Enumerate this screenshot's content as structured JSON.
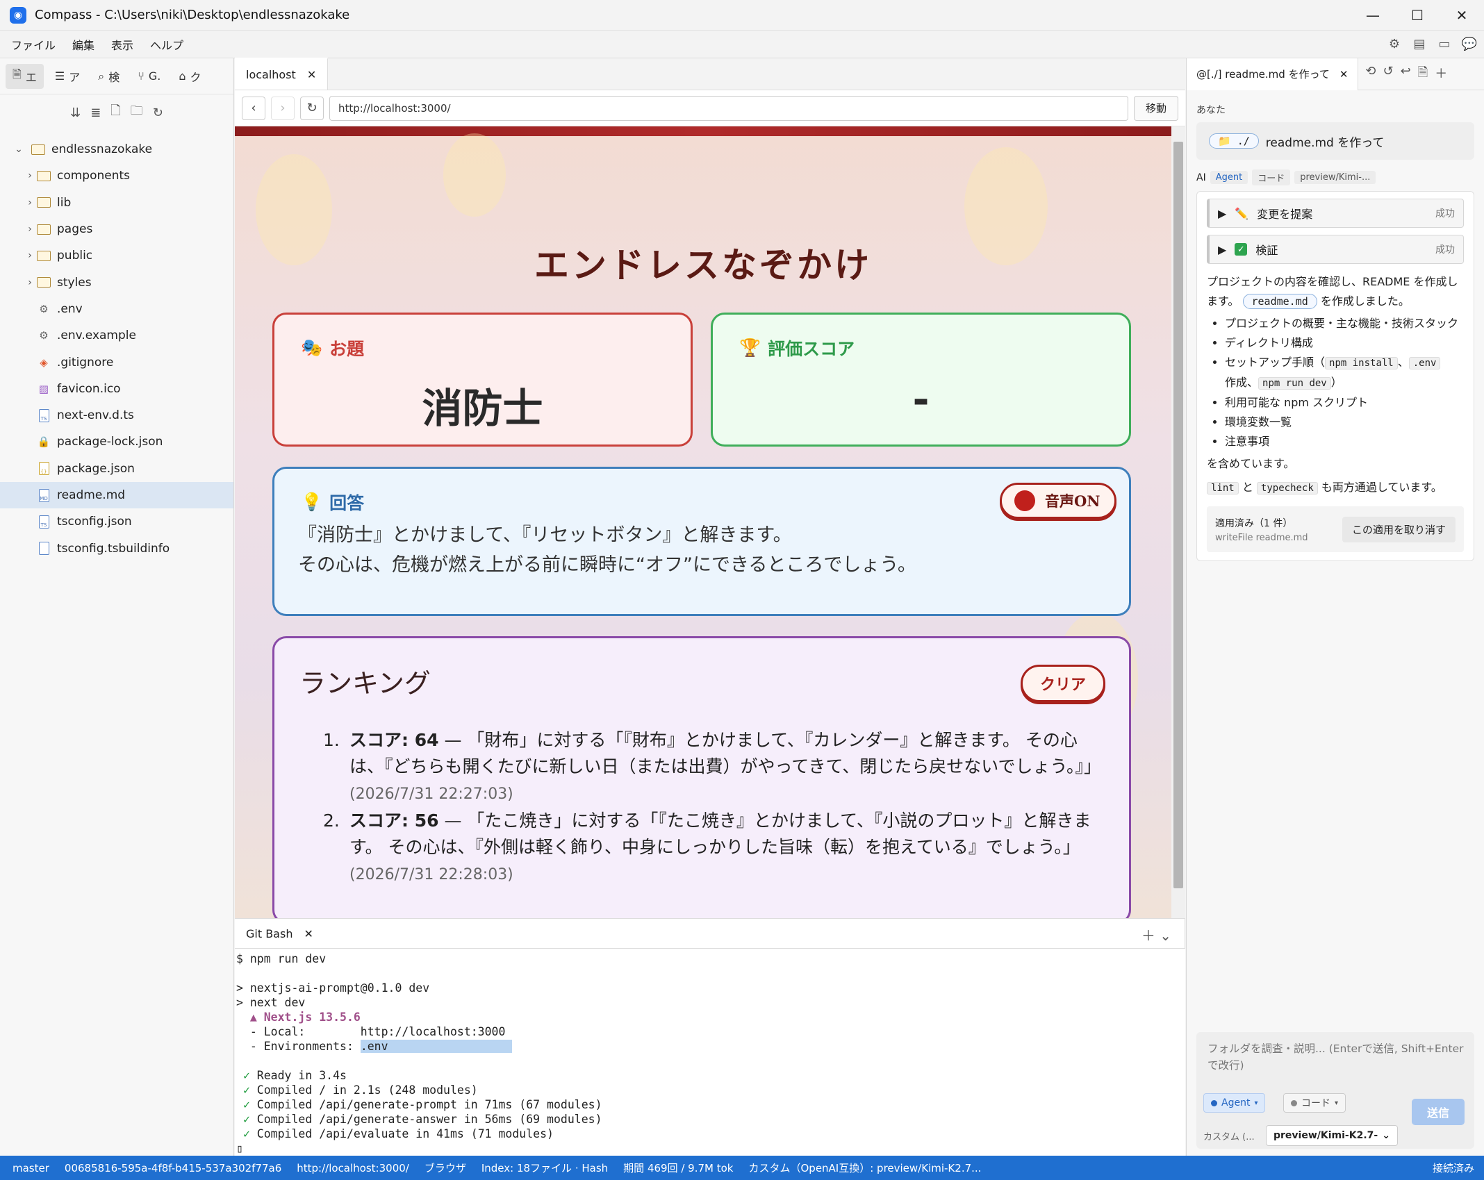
{
  "window": {
    "title": "Compass - C:\\Users\\niki\\Desktop\\endlessnazokake",
    "minimize": "—",
    "maximize": "☐",
    "close": "✕"
  },
  "menu": [
    "ファイル",
    "編集",
    "表示",
    "ヘルプ"
  ],
  "sidebar": {
    "tabs": [
      {
        "icon": "explorer-icon",
        "label": "エ"
      },
      {
        "icon": "outline-icon",
        "label": "ア"
      },
      {
        "icon": "search-icon",
        "label": "検"
      },
      {
        "icon": "git-icon",
        "label": "G."
      },
      {
        "icon": "package-icon",
        "label": "ク"
      }
    ],
    "root": "endlessnazokake",
    "items": [
      {
        "type": "folder",
        "label": "components"
      },
      {
        "type": "folder",
        "label": "lib"
      },
      {
        "type": "folder",
        "label": "pages"
      },
      {
        "type": "folder",
        "label": "public"
      },
      {
        "type": "folder",
        "label": "styles"
      },
      {
        "type": "gear",
        "label": ".env"
      },
      {
        "type": "gear",
        "label": ".env.example"
      },
      {
        "type": "git",
        "label": ".gitignore"
      },
      {
        "type": "image",
        "label": "favicon.ico"
      },
      {
        "type": "ts",
        "label": "next-env.d.ts"
      },
      {
        "type": "lock",
        "label": "package-lock.json"
      },
      {
        "type": "json",
        "label": "package.json"
      },
      {
        "type": "md",
        "label": "readme.md"
      },
      {
        "type": "ts",
        "label": "tsconfig.json"
      },
      {
        "type": "file",
        "label": "tsconfig.tsbuildinfo"
      }
    ]
  },
  "browser": {
    "tab_label": "localhost",
    "url": "http://localhost:3000/",
    "go_label": "移動"
  },
  "app": {
    "title": "エンドレスなぞかけ",
    "theme_label": "お題",
    "theme_value": "消防士",
    "score_label": "評価スコア",
    "score_value": "-",
    "answer_label": "回答",
    "voice_label": "音声ON",
    "answer_line1": "『消防士』とかけまして、『リセットボタン』と解きます。",
    "answer_line2": "その心は、危機が燃え上がる前に瞬時に“オフ”にできるところでしょう。",
    "ranking_title": "ランキング",
    "clear_label": "クリア",
    "ranking": [
      {
        "num": "1.",
        "score": "スコア: 64",
        "text": " — 「財布」に対する「『財布』とかけまして、『カレンダー』と解きます。 その心は、『どちらも開くたびに新しい日（または出費）がやってきて、閉じたら戻せないでしょう。』」",
        "time": "(2026/7/31 22:27:03)"
      },
      {
        "num": "2.",
        "score": "スコア: 56",
        "text": " — 「たこ焼き」に対する「『たこ焼き』とかけまして、『小説のプロット』と解きます。 その心は、『外側は軽く飾り、中身にしっかりした旨味（転）を抱えている』でしょう。」",
        "time": "(2026/7/31 22:28:03)"
      }
    ]
  },
  "terminal": {
    "tab_label": "Git Bash",
    "lines": [
      "$ npm run dev",
      "",
      "> nextjs-ai-prompt@0.1.0 dev",
      "> next dev",
      "  ▲ Next.js 13.5.6",
      "  - Local:        http://localhost:3000",
      "  - Environments: .env",
      "",
      " ✓ Ready in 3.4s",
      " ✓ Compiled / in 2.1s (248 modules)",
      " ✓ Compiled /api/generate-prompt in 71ms (67 modules)",
      " ✓ Compiled /api/generate-answer in 56ms (69 modules)",
      " ✓ Compiled /api/evaluate in 41ms (71 modules)"
    ]
  },
  "chat": {
    "tab_label": "@[./] readme.md を作って",
    "you_label": "あなた",
    "you_chip": "./",
    "you_message": "readme.md を作って",
    "ai_label": "AI",
    "ai_tags": [
      "Agent",
      "コード",
      "preview/Kimi-..."
    ],
    "steps": [
      {
        "label": "変更を提案",
        "status": "成功"
      },
      {
        "label": "検証",
        "status": "成功"
      }
    ],
    "intro_a": "プロジェクトの内容を確認し、README を作成します。",
    "intro_chip": "readme.md",
    "intro_b": "を作成しました。",
    "bullets": [
      "プロジェクトの概要・主な機能・技術スタック",
      "ディレクトリ構成",
      "セットアップ手順（",
      "利用可能な npm スクリプト",
      "環境変数一覧",
      "注意事項"
    ],
    "bullet3_code1": "npm install",
    "bullet3_sep": "、",
    "bullet3_code2": ".env",
    "bullet3_mid": "作成、",
    "bullet3_code3": "npm run dev",
    "bullet3_end": "）",
    "outro": "を含めています。",
    "check_code1": "lint",
    "check_and": "と",
    "check_code2": "typecheck",
    "check_tail": "も両方通過しています。",
    "applied_title": "適用済み（1 件）",
    "applied_file": "writeFile readme.md",
    "undo_label": "この適用を取り消す",
    "composer_placeholder": "フォルダを調査・説明... (Enterで送信, Shift+Enterで改行)",
    "mode_agent": "Agent",
    "mode_code": "コード",
    "send_label": "送信",
    "custom_label": "カスタム (...",
    "model_value": "preview/Kimi-K2.7-"
  },
  "status": {
    "branch": "master",
    "session": "00685816-595a-4f8f-b415-537a302f77a6",
    "url": "http://localhost:3000/",
    "view": "ブラウザ",
    "index": "Index: 18ファイル · Hash",
    "usage": "期間 469回 / 9.7M tok",
    "model": "カスタム（OpenAI互換）: preview/Kimi-K2.7...",
    "connection": "接続済み"
  },
  "colors": {
    "accent": "#1f6fd0",
    "theme_border": "#c9403a",
    "score_border": "#3fae5a",
    "answer_border": "#3e7fbc",
    "ranking_border": "#8a4aa8"
  }
}
